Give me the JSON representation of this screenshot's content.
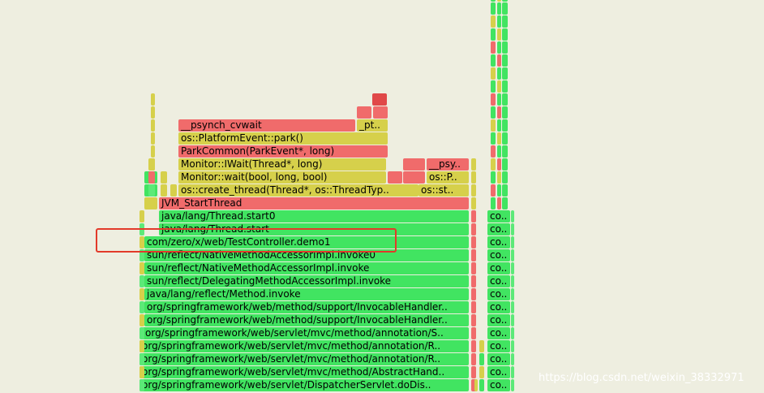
{
  "colors": {
    "green": "#41e461",
    "green_dark": "#2ed552",
    "green_light": "#5ce978",
    "yellow": "#d6d04b",
    "yellow_light": "#d9d05b",
    "red": "#f06b6b",
    "red_dark": "#e04848",
    "highlight": "#e23a2a"
  },
  "main_frames": [
    {
      "label": "org/springframework/web/servlet/DispatcherServlet.doDis..",
      "color": "green"
    },
    {
      "label": "org/springframework/web/servlet/mvc/method/AbstractHand..",
      "color": "green"
    },
    {
      "label": "org/springframework/web/servlet/mvc/method/annotation/R..",
      "color": "green"
    },
    {
      "label": "org/springframework/web/servlet/mvc/method/annotation/R..",
      "color": "green"
    },
    {
      "label": "org/springframework/web/servlet/mvc/method/annotation/S..",
      "color": "green"
    },
    {
      "label": "org/springframework/web/method/support/InvocableHandler..",
      "color": "green"
    },
    {
      "label": "org/springframework/web/method/support/InvocableHandler..",
      "color": "green"
    },
    {
      "label": "java/lang/reflect/Method.invoke",
      "color": "green"
    },
    {
      "label": "sun/reflect/DelegatingMethodAccessorImpl.invoke",
      "color": "green"
    },
    {
      "label": "sun/reflect/NativeMethodAccessorImpl.invoke",
      "color": "green"
    },
    {
      "label": "sun/reflect/NativeMethodAccessorImpl.invoke0",
      "color": "green"
    },
    {
      "label": "com/zero/x/web/TestController.demo1",
      "color": "green"
    },
    {
      "label": "java/lang/Thread.start",
      "color": "green"
    },
    {
      "label": "java/lang/Thread.start0",
      "color": "green"
    },
    {
      "label": "JVM_StartThread",
      "color": "red"
    },
    {
      "label": "os::create_thread(Thread*, os::ThreadTyp..",
      "color": "yellow"
    },
    {
      "label": "Monitor::wait(bool, long, bool)",
      "color": "yellow"
    },
    {
      "label": "Monitor::IWait(Thread*, long)",
      "color": "yellow"
    },
    {
      "label": "ParkCommon(ParkEvent*, long)",
      "color": "red"
    },
    {
      "label": "os::PlatformEvent::park()",
      "color": "yellow"
    },
    {
      "label": "__psynch_cvwait",
      "color": "red"
    }
  ],
  "side_frames": {
    "os_st": "os::st..",
    "os_p": "os::P..",
    "psy": "__psy..",
    "pt": "_pt.."
  },
  "co_label": "co..",
  "highlighted_frame": "com/zero/x/web/TestController.demo1",
  "watermark": "https://blog.csdn.net/weixin_38332971"
}
